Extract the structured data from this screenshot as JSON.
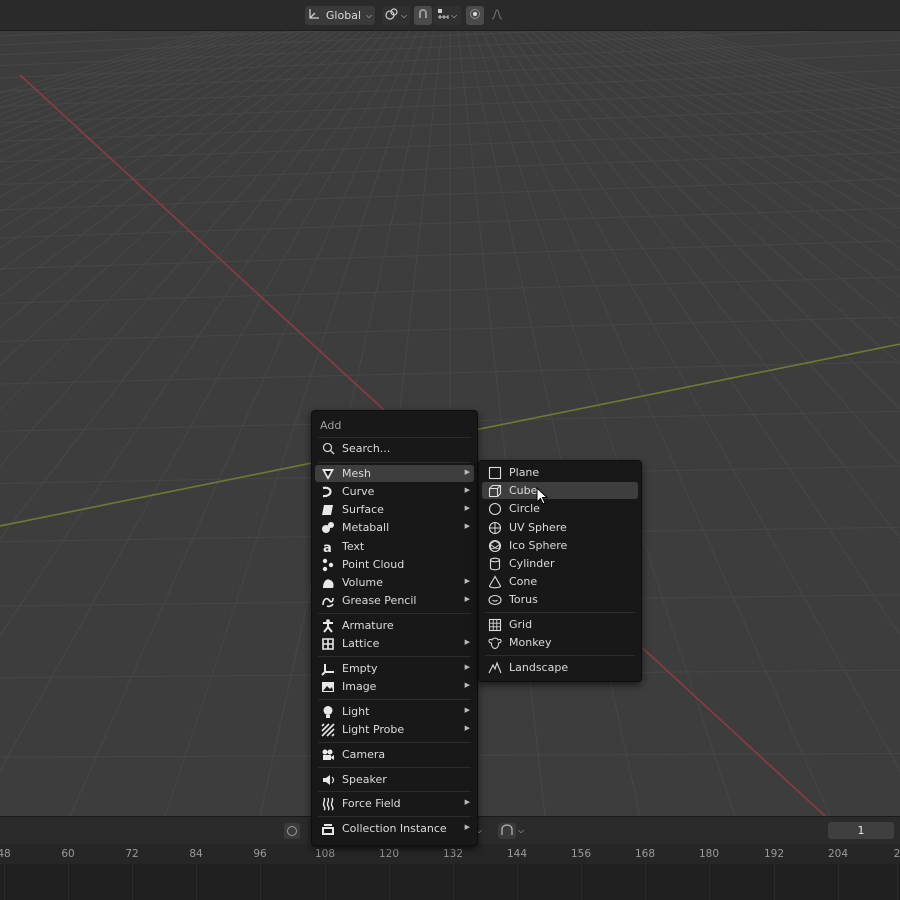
{
  "header": {
    "orientation_label": "Global",
    "orientation_icon": "transform-orientation-icon",
    "pivot_icon": "pivot-point-icon",
    "snap_icon": "snap-magnet-icon",
    "snap_target_icon": "snap-increment-icon",
    "proportional_icon": "proportional-editing-icon",
    "falloff_icon": "falloff-curve-icon"
  },
  "add_menu": {
    "title": "Add",
    "search_label": "Search...",
    "items": [
      {
        "label": "Mesh",
        "icon": "mesh-icon",
        "submenu": true
      },
      {
        "label": "Curve",
        "icon": "curve-icon",
        "submenu": true
      },
      {
        "label": "Surface",
        "icon": "surface-icon",
        "submenu": true
      },
      {
        "label": "Metaball",
        "icon": "metaball-icon",
        "submenu": true
      },
      {
        "label": "Text",
        "icon": "text-icon",
        "submenu": false
      },
      {
        "label": "Point Cloud",
        "icon": "point-cloud-icon",
        "submenu": false
      },
      {
        "label": "Volume",
        "icon": "volume-icon",
        "submenu": true
      },
      {
        "label": "Grease Pencil",
        "icon": "grease-pencil-icon",
        "submenu": true
      },
      {
        "label": "Armature",
        "icon": "armature-icon",
        "submenu": false
      },
      {
        "label": "Lattice",
        "icon": "lattice-icon",
        "submenu": true
      },
      {
        "label": "Empty",
        "icon": "empty-icon",
        "submenu": true
      },
      {
        "label": "Image",
        "icon": "image-icon",
        "submenu": true
      },
      {
        "label": "Light",
        "icon": "light-icon",
        "submenu": true
      },
      {
        "label": "Light Probe",
        "icon": "light-probe-icon",
        "submenu": true
      },
      {
        "label": "Camera",
        "icon": "camera-icon",
        "submenu": false
      },
      {
        "label": "Speaker",
        "icon": "speaker-icon",
        "submenu": false
      },
      {
        "label": "Force Field",
        "icon": "force-field-icon",
        "submenu": true
      },
      {
        "label": "Collection Instance",
        "icon": "collection-icon",
        "submenu": true
      }
    ]
  },
  "mesh_menu": {
    "items": [
      {
        "label": "Plane",
        "icon": "plane-icon"
      },
      {
        "label": "Cube",
        "icon": "cube-icon"
      },
      {
        "label": "Circle",
        "icon": "circle-icon"
      },
      {
        "label": "UV Sphere",
        "icon": "uv-sphere-icon"
      },
      {
        "label": "Ico Sphere",
        "icon": "ico-sphere-icon"
      },
      {
        "label": "Cylinder",
        "icon": "cylinder-icon"
      },
      {
        "label": "Cone",
        "icon": "cone-icon"
      },
      {
        "label": "Torus",
        "icon": "torus-icon"
      },
      {
        "label": "Grid",
        "icon": "grid-icon"
      },
      {
        "label": "Monkey",
        "icon": "monkey-icon"
      },
      {
        "label": "Landscape",
        "icon": "landscape-icon"
      }
    ],
    "highlighted": "Cube"
  },
  "timeline": {
    "current_frame": "1",
    "ticks": [
      "48",
      "60",
      "72",
      "84",
      "96",
      "108",
      "120",
      "132",
      "144",
      "156",
      "168",
      "180",
      "192",
      "204",
      "2"
    ]
  },
  "colors": {
    "x_axis": "#8c3b45",
    "y_axis": "#6b7d33",
    "menu_bg": "#181818",
    "highlight": "#3e3e3e"
  }
}
